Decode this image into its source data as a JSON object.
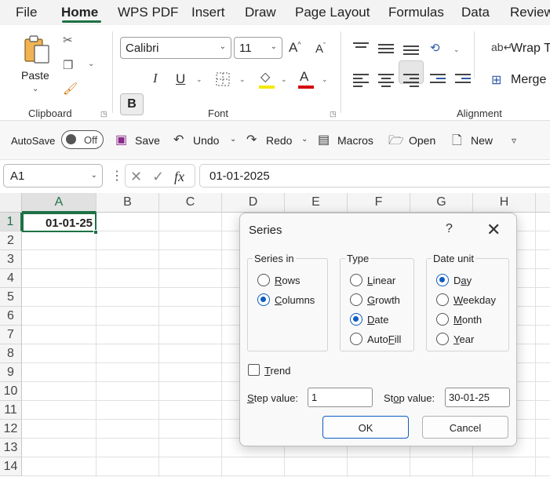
{
  "menu": {
    "items": [
      {
        "label": "File"
      },
      {
        "label": "Home"
      },
      {
        "label": "WPS PDF"
      },
      {
        "label": "Insert"
      },
      {
        "label": "Draw"
      },
      {
        "label": "Page Layout"
      },
      {
        "label": "Formulas"
      },
      {
        "label": "Data"
      },
      {
        "label": "Review"
      }
    ],
    "active": "Home"
  },
  "ribbon": {
    "clipboard": {
      "paste_label": "Paste",
      "group_label": "Clipboard"
    },
    "font": {
      "font_name": "Calibri",
      "font_size": "11",
      "group_label": "Font",
      "grow_label": "A^",
      "shrink_label": "Aˇ"
    },
    "alignment": {
      "wrap_label": "Wrap Te",
      "merge_label": "Merge &",
      "group_label": "Alignment"
    },
    "colors": {
      "highlight": "#f5e800",
      "font_color": "#d40000"
    }
  },
  "qat": {
    "autosave_label": "AutoSave",
    "toggle_label": "Off",
    "save_label": "Save",
    "undo_label": "Undo",
    "redo_label": "Redo",
    "macros_label": "Macros",
    "open_label": "Open",
    "new_label": "New"
  },
  "formula_bar": {
    "name_box": "A1",
    "formula": "01-01-2025",
    "fx": "fx"
  },
  "grid": {
    "columns": [
      "A",
      "B",
      "C",
      "D",
      "E",
      "F",
      "G",
      "H"
    ],
    "rows": [
      "1",
      "2",
      "3",
      "4",
      "5",
      "6",
      "7",
      "8",
      "9",
      "10",
      "11",
      "12",
      "13",
      "14"
    ],
    "active_cell_value": "01-01-25"
  },
  "dialog": {
    "title": "Series",
    "help": "?",
    "close": "✕",
    "series_in": {
      "legend": "Series in",
      "options": [
        {
          "pre": "",
          "key": "R",
          "post": "ows",
          "selected": false
        },
        {
          "pre": "",
          "key": "C",
          "post": "olumns",
          "selected": true
        }
      ]
    },
    "type": {
      "legend": "Type",
      "options": [
        {
          "pre": "",
          "key": "L",
          "post": "inear",
          "selected": false
        },
        {
          "pre": "",
          "key": "G",
          "post": "rowth",
          "selected": false
        },
        {
          "pre": "",
          "key": "D",
          "post": "ate",
          "selected": true
        },
        {
          "pre": "Auto",
          "key": "F",
          "post": "ill",
          "selected": false
        }
      ]
    },
    "date_unit": {
      "legend": "Date unit",
      "options": [
        {
          "pre": "D",
          "key": "a",
          "post": "y",
          "selected": true
        },
        {
          "pre": "",
          "key": "W",
          "post": "eekday",
          "selected": false
        },
        {
          "pre": "",
          "key": "M",
          "post": "onth",
          "selected": false
        },
        {
          "pre": "",
          "key": "Y",
          "post": "ear",
          "selected": false
        }
      ]
    },
    "trend": {
      "key": "T",
      "post": "rend",
      "checked": false
    },
    "step": {
      "pre": "",
      "key": "S",
      "post": "tep value:",
      "value": "1"
    },
    "stop": {
      "pre": "St",
      "key": "o",
      "post": "p value:",
      "value": "30-01-25"
    },
    "ok_label": "OK",
    "cancel_label": "Cancel"
  }
}
